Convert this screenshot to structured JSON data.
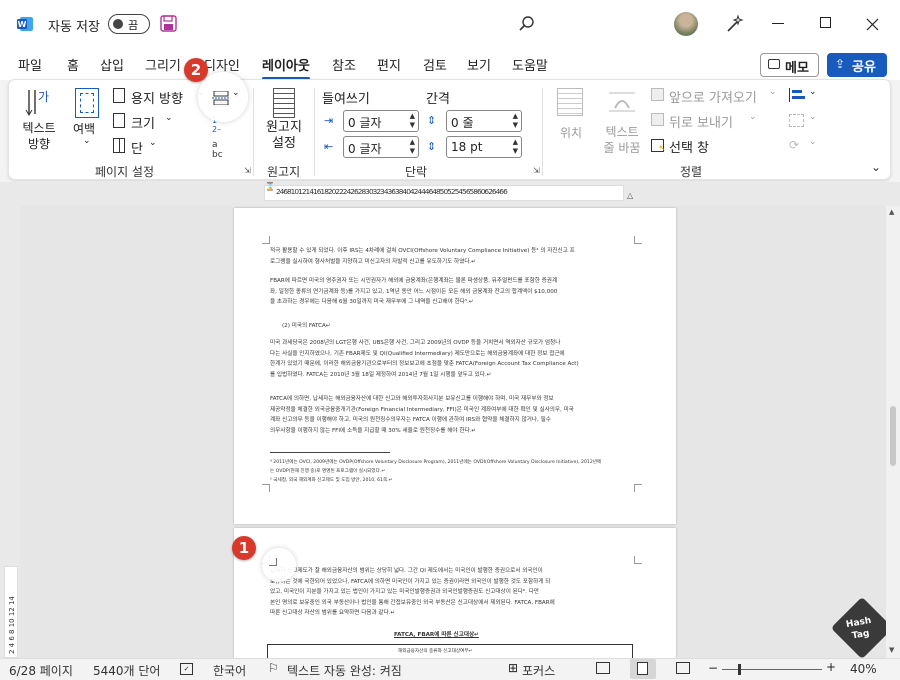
{
  "title_bar": {
    "autosave_label": "자동 저장",
    "autosave_state": "끔",
    "window_controls": [
      "minimize-icon",
      "maximize-icon",
      "close-icon"
    ]
  },
  "menu": {
    "tabs": [
      "파일",
      "홈",
      "삽입",
      "그리기",
      "디자인",
      "레이아웃",
      "참조",
      "편지",
      "검토",
      "보기",
      "도움말"
    ],
    "active_tab": "레이아웃",
    "memo_label": "메모",
    "share_label": "공유"
  },
  "ribbon": {
    "page_setup": {
      "text_direction": "텍스트\n방향",
      "margins": "여백",
      "orientation": "용지 방향",
      "size": "크기",
      "columns": "단",
      "group_label": "페이지 설정"
    },
    "manuscript": {
      "label": "원고지\n설정",
      "group_label": "원고지"
    },
    "paragraph": {
      "indent_header": "들여쓰기",
      "spacing_header": "간격",
      "indent_left": "0 글자",
      "indent_right": "0 글자",
      "spacing_before": "0 줄",
      "spacing_after": "18 pt",
      "group_label": "단락"
    },
    "arrange": {
      "position": "위치",
      "wrap_text": "텍스트\n줄 바꿈",
      "bring_forward": "앞으로 가져오기",
      "send_backward": "뒤로 보내기",
      "selection_pane": "선택 창",
      "group_label": "정렬"
    },
    "accent_color": "#185abd",
    "badge_color": "#d9392b"
  },
  "ruler": {
    "ticks": "2 4 6 8 10 12 14 16 18 20 22 24 26 28 30 32 34 36 38 40 42 44 46 48 50 52 54 56 58 60 62 64 66",
    "vertical_ticks": "2 4 6 8 10 12 14"
  },
  "document": {
    "page1": {
      "p1": "적극 활용할 수 있게 되었다. 이후 IRS는 4차례에 걸쳐 OVCI(Offshore Voluntary Compliance Initiative) 등⁴ 의 자진신고 프\n로그램을 실시하여 형사처벌을 지양하고 미신고자의 자발적 신고를 유도하기도 하였다.↵",
      "p2": "FBAR에 따르면 미국의 영주권자 또는 시민권자가 해외에 금융계좌(은행계좌는 물론 파생상품, 뮤추얼펀드를 포함한 증권계\n좌, 일정한 종류의 연기금계좌 등)를 가지고 있고, 1역년 동안 어느 시점이든 모든 해외 금융계좌 잔고의 합계액이 $10,000\n을 초과하는 경우에는 다음해 6월 30일까지 미국 재무부에 그 내역을 신고해야 한다⁵.↵",
      "p3": "(2) 미국의 FATCA↵",
      "p4": "미국 과세당국은 2008년의 LGT은행 사건, UBS은행 사건, 그리고 2009년의 OVDP 등을 거치면서 역외자산 규모가 엄청나\n다는 사실을 인지하였으나, 기존 FBAR제도 및 QI(Qualified Intermediary) 제도만으로는 해외금융계좌에 대한 정보 접근에\n한계가 있었기 때문에, 이러한 해외금융기관으로부터의 정보보고에 초점을 맞춘 FATCA(Foreign Account Tax Compliance Act)\n를 입법하였다. FATCA는 2010년 3월 18일 제정하여 2014년 7월 1일 시행을 앞두고 있다.↵",
      "p5": "FATCA에 의하면, 납세자는 해외금융자산에 대한 신고와 해외투자회사지분 보유신고를 이행해야 하며, 미국 재무부와 정보\n제공약정을 체결한 외국금융중개기관(Foreign Financial Intermediary, FFI)은 미국인 계좌여부에 대한 확인 및 실사의무, 미국\n계좌 신고의무 등을 이행해야 하고, 미국의 원천징수의무자는 FATCA 이행에 관하여 IRS와 협약을 체결하지 않거나, 필수\n의무사항을 이행하지 않는 FFI에 소득을 지급할 때 30% 세율로 원천징수를 해야 한다.↵",
      "footnotes": "⁴ 2011년에는 OVCI, 2009년에는 OVDP(Offshore Voluntary Disclosure Program), 2011년에는 OVDI(Offshore Voluntary Disclosure Initiative), 2012년에\n는 OVDP(현재 진행 중)로 명명된 프로그램이 실시되었다.↵\n⁵ 국세청, 외국 해외계좌 신고제도 및 도입 방안, 2010, 61쪽.↵"
    },
    "page2": {
      "p1": "납세자 신고제도가 잘 해외금융자산의 범위는 상당히 넓다. 그간 QI 제도에서는 미국인이 발행한 증권으로서 외국인이\n보유하는 것에 국한되어 있었으나, FATCA에 의하면 미국인이 가지고 있는 증권이라면 외국인이 발행한 것도 포함하게 되\n었고, 미국인이 지분을 가지고 있는 법인이 가지고 있는 미국인발행증권과 외국인발행증권도 신고대상이 된다⁶. 다만\n본인 명의로 보유중인 외국 부동산이나 법인을 통해 간접보유중인 외국 부동산은 신고대상에서 제외된다. FATCA, FBAR에\n따른 신고대상 자산의 범위를 요약하면 다음과 같다.↵",
      "table_title": "FATCA, FBAR에 따른 신고대상↵",
      "table_subtitle": "해외금융자산의 종류와 신고대상여부↵"
    }
  },
  "badges": {
    "one": "1",
    "two": "2"
  },
  "status_bar": {
    "page": "6/28 페이지",
    "words": "5440개 단어",
    "language": "한국어",
    "autocomplete": "텍스트 자동 완성: 켜짐",
    "focus": "포커스",
    "zoom": "40%"
  },
  "watermark": {
    "line1": "Hash",
    "line2": "Tag"
  }
}
